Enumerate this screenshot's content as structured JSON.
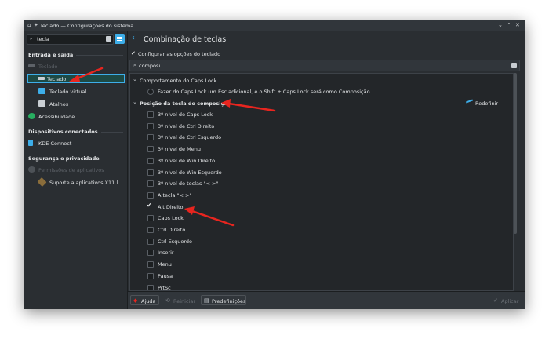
{
  "window": {
    "title": "Teclado — Configurações do sistema",
    "controls": [
      "⌄",
      "⌃",
      "✕"
    ]
  },
  "sidebar": {
    "search_value": "tecla",
    "sections": {
      "input_output": "Entrada e saída",
      "connected": "Dispositivos conectados",
      "security": "Segurança e privacidade"
    },
    "items": {
      "keyboard_parent": "Teclado",
      "keyboard": "Teclado",
      "virtual_keyboard": "Teclado virtual",
      "shortcuts": "Atalhos",
      "accessibility": "Acessibilidade",
      "kde_connect": "KDE Connect",
      "app_permissions": "Permissões de aplicativos",
      "x11_support": "Suporte a aplicativos X11 l..."
    }
  },
  "main": {
    "title": "Combinação de teclas",
    "configure_label": "Configurar as opções do teclado",
    "search_value": "composi",
    "reset_label": "Redefinir",
    "caps_group": "Comportamento do Caps Lock",
    "caps_option": "Fazer do Caps Lock um Esc adicional, e o Shift + Caps Lock será como Composição",
    "compose_group": "Posição da tecla de composição",
    "options": [
      "3º nível de Caps Lock",
      "3º nível de Ctrl Direito",
      "3º nível de Ctrl Esquerdo",
      "3º nível de Menu",
      "3º nível de Win Direito",
      "3º nível de Win Esquerdo",
      "3º nível de teclas \"< >\"",
      "A tecla \"< >\"",
      "Alt Direito",
      "Caps Lock",
      "Ctrl Direito",
      "Ctrl Esquerdo",
      "Inserir",
      "Menu",
      "Pausa",
      "PrtSc"
    ],
    "checked_option": "Alt Direito"
  },
  "footer": {
    "help": "Ajuda",
    "reset": "Reiniciar",
    "defaults": "Predefinições",
    "apply": "Aplicar"
  },
  "colors": {
    "accent": "#3daee9",
    "annotation_arrow": "#e8251f",
    "active_item_bg": "#1d4a45"
  }
}
